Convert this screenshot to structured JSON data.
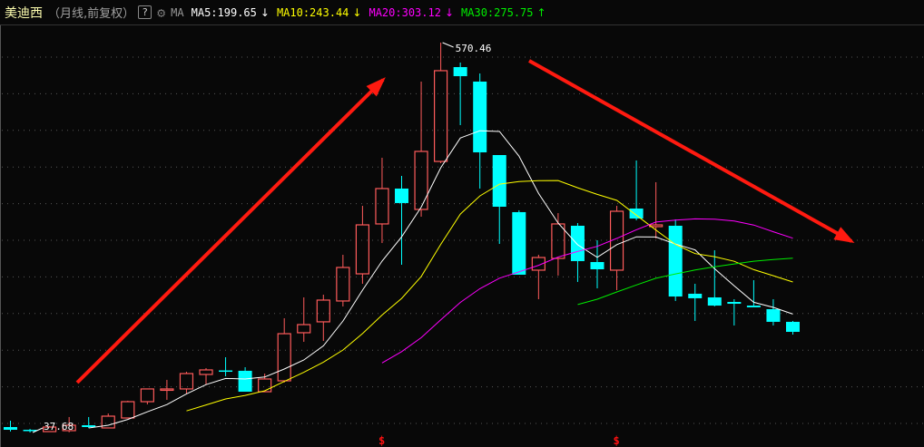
{
  "header": {
    "stock_name": "美迪西",
    "period": "（月线,前复权）",
    "help_label": "?",
    "gear_icon": "gear-icon",
    "ma_label": "MA",
    "ma": [
      {
        "text": "MA5:199.65",
        "trend": "↓",
        "color": "#ffffff"
      },
      {
        "text": "MA10:243.44",
        "trend": "↓",
        "color": "#ffff00"
      },
      {
        "text": "MA20:303.12",
        "trend": "↓",
        "color": "#ff00ff"
      },
      {
        "text": "MA30:275.75",
        "trend": "↑",
        "color": "#00ee00"
      }
    ]
  },
  "colors": {
    "up": "#ff5b5b",
    "down": "#00ffff",
    "grid": "#555555",
    "annotation": "#ff1a10"
  },
  "chart_data": {
    "type": "candlestick",
    "title": "美迪西 (月线,前复权)",
    "ylim": [
      37.68,
      570.46
    ],
    "high_label": "570.46",
    "low_label": "37.68",
    "markers": [
      "$",
      "$"
    ],
    "marker_indices": [
      19,
      31
    ],
    "ma_periods": [
      5,
      10,
      20,
      30
    ],
    "ohlc": [
      [
        45.1,
        53.8,
        39.0,
        41.4
      ],
      [
        41.4,
        42.6,
        37.68,
        40.2
      ],
      [
        38.9,
        46.4,
        38.9,
        45.1
      ],
      [
        40.2,
        58.8,
        38.0,
        47.6
      ],
      [
        47.6,
        58.8,
        43.9,
        45.1
      ],
      [
        43.9,
        63.7,
        43.9,
        60.0
      ],
      [
        57.5,
        81.1,
        57.5,
        79.8
      ],
      [
        79.8,
        97.2,
        76.1,
        97.2
      ],
      [
        96.0,
        109.6,
        82.3,
        97.2
      ],
      [
        97.2,
        120.7,
        90.9,
        118.2
      ],
      [
        117.0,
        125.7,
        103.4,
        123.2
      ],
      [
        122.5,
        140.5,
        114.5,
        122.0
      ],
      [
        122.0,
        126.9,
        93.4,
        93.4
      ],
      [
        93.4,
        118.2,
        93.4,
        110.8
      ],
      [
        108.3,
        193.8,
        106.0,
        172.7
      ],
      [
        174.0,
        222.3,
        161.6,
        185.1
      ],
      [
        188.9,
        226.0,
        162.8,
        218.6
      ],
      [
        217.4,
        280.5,
        209.9,
        263.2
      ],
      [
        254.5,
        347.4,
        240.9,
        321.4
      ],
      [
        322.7,
        413.1,
        296.6,
        371.0
      ],
      [
        371.0,
        388.3,
        266.9,
        351.2
      ],
      [
        342.5,
        517.2,
        332.6,
        421.8
      ],
      [
        408.1,
        570.46,
        405.7,
        532.1
      ],
      [
        537.0,
        543.2,
        457.7,
        524.6
      ],
      [
        517.2,
        528.3,
        371.0,
        420.5
      ],
      [
        416.8,
        416.8,
        295.4,
        346.2
      ],
      [
        338.8,
        341.3,
        253.3,
        253.3
      ],
      [
        259.5,
        280.5,
        219.8,
        276.8
      ],
      [
        275.6,
        337.5,
        252.1,
        322.7
      ],
      [
        320.2,
        323.9,
        243.4,
        271.9
      ],
      [
        270.6,
        300.4,
        234.7,
        260.7
      ],
      [
        259.5,
        347.4,
        232.2,
        340.0
      ],
      [
        343.7,
        409.4,
        327.6,
        330.1
      ],
      [
        319.0,
        379.7,
        302.8,
        321.4
      ],
      [
        320.2,
        328.9,
        217.4,
        223.5
      ],
      [
        227.3,
        240.9,
        190.1,
        221.1
      ],
      [
        222.3,
        286.7,
        209.9,
        211.1
      ],
      [
        216.1,
        219.8,
        183.9,
        213.6
      ],
      [
        211.1,
        245.8,
        208.7,
        208.7
      ],
      [
        206.2,
        219.8,
        183.9,
        188.9
      ],
      [
        188.9,
        190.1,
        171.5,
        175.2
      ]
    ]
  }
}
